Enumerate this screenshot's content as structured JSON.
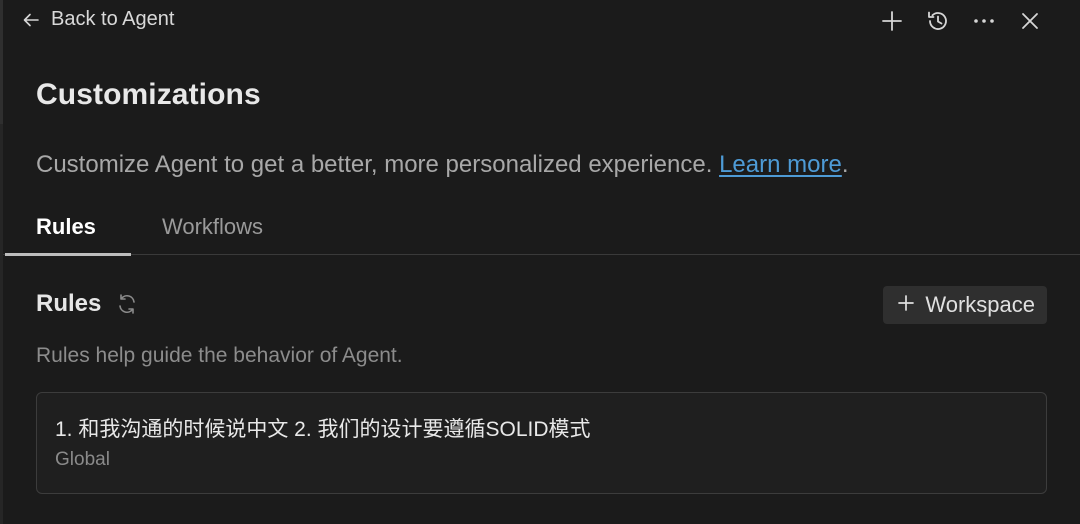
{
  "topbar": {
    "back_label": "Back to Agent",
    "icons": [
      "arrow-left-icon",
      "plus-icon",
      "history-icon",
      "more-icon",
      "close-icon"
    ]
  },
  "header": {
    "title": "Customizations",
    "description": "Customize Agent to get a better, more personalized experience.",
    "learn_more": "Learn more",
    "description_end": "."
  },
  "tabs": [
    {
      "label": "Rules",
      "active": true
    },
    {
      "label": "Workflows",
      "active": false
    }
  ],
  "rules_section": {
    "title": "Rules",
    "add_button_label": "Workspace",
    "description": "Rules help guide the behavior of Agent.",
    "items": [
      {
        "text": "1. 和我沟通的时候说中文 2. 我们的设计要遵循SOLID模式",
        "scope": "Global"
      }
    ]
  },
  "colors": {
    "background": "#1b1b1b",
    "link": "#4e9bd6",
    "button_bg": "#2f2f2f",
    "border": "#3c3c3c"
  }
}
